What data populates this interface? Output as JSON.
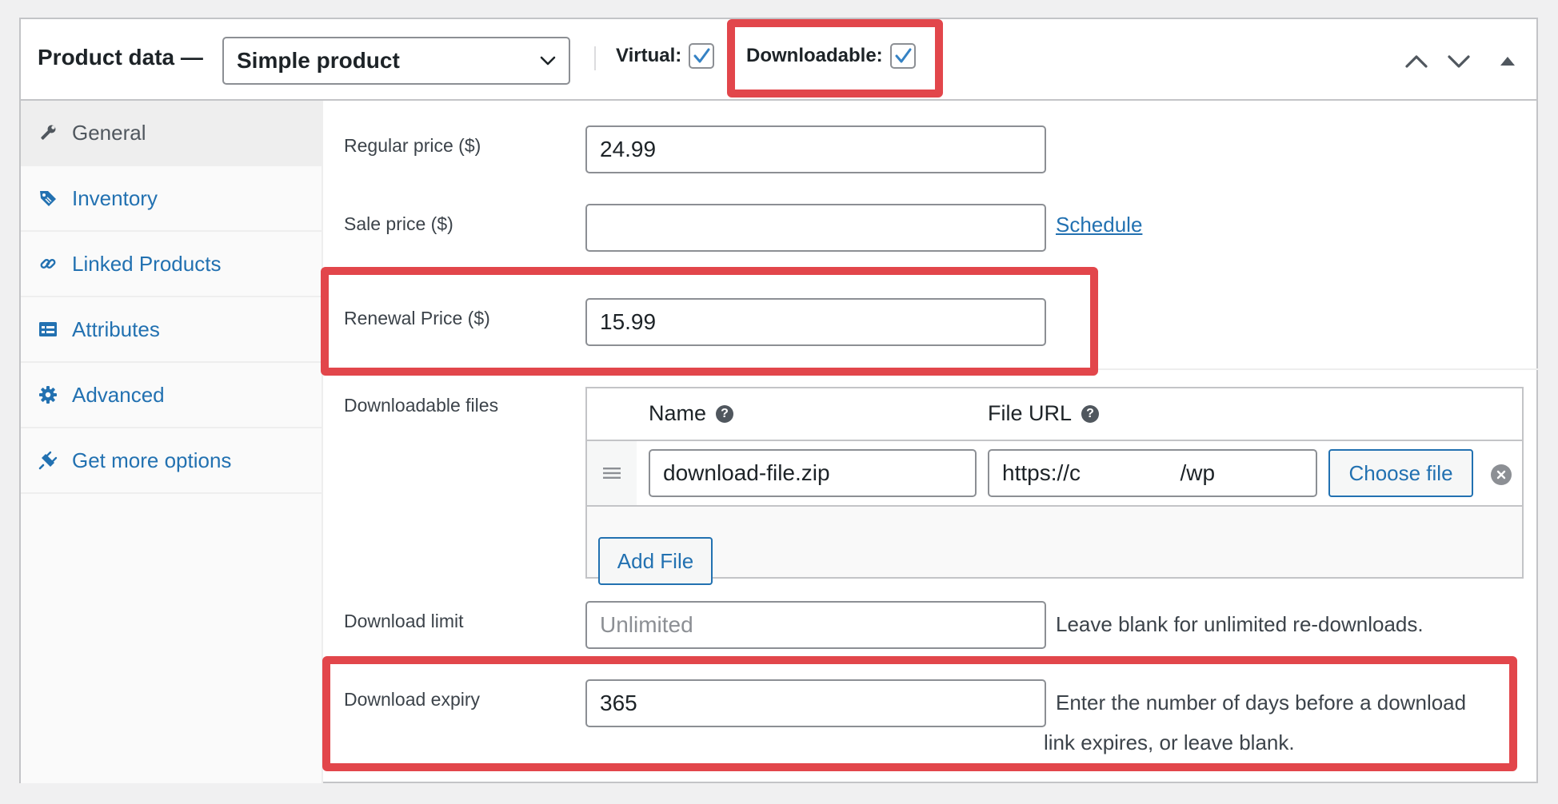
{
  "header": {
    "title": "Product data —",
    "product_type": "Simple product",
    "virtual_label": "Virtual:",
    "virtual_checked": true,
    "downloadable_label": "Downloadable:",
    "downloadable_checked": true
  },
  "sidebar": {
    "tabs": [
      {
        "label": "General",
        "icon": "wrench-icon",
        "active": true
      },
      {
        "label": "Inventory",
        "icon": "tag-icon",
        "active": false
      },
      {
        "label": "Linked Products",
        "icon": "link-icon",
        "active": false
      },
      {
        "label": "Attributes",
        "icon": "table-icon",
        "active": false
      },
      {
        "label": "Advanced",
        "icon": "gear-icon",
        "active": false
      },
      {
        "label": "Get more options",
        "icon": "plugin-icon",
        "active": false
      }
    ]
  },
  "general": {
    "regular_price_label": "Regular price ($)",
    "regular_price": "24.99",
    "sale_price_label": "Sale price ($)",
    "sale_price": "",
    "schedule_link": "Schedule",
    "renewal_price_label": "Renewal Price ($)",
    "renewal_price": "15.99",
    "downloadable_files_label": "Downloadable files",
    "files_table": {
      "name_header": "Name",
      "url_header": "File URL",
      "help_glyph": "?",
      "rows": [
        {
          "name": "download-file.zip",
          "url": "https://c                /wp"
        }
      ],
      "choose_file_label": "Choose file",
      "add_file_label": "Add File"
    },
    "download_limit_label": "Download limit",
    "download_limit": "",
    "download_limit_placeholder": "Unlimited",
    "download_limit_desc": "Leave blank for unlimited re-downloads.",
    "download_expiry_label": "Download expiry",
    "download_expiry": "365",
    "download_expiry_desc_line1": "Enter the number of days before a download",
    "download_expiry_desc_line2": "link expires, or leave blank."
  },
  "colors": {
    "highlight": "#e2464b",
    "link": "#2271b1",
    "checkbox": "#3582c4"
  }
}
